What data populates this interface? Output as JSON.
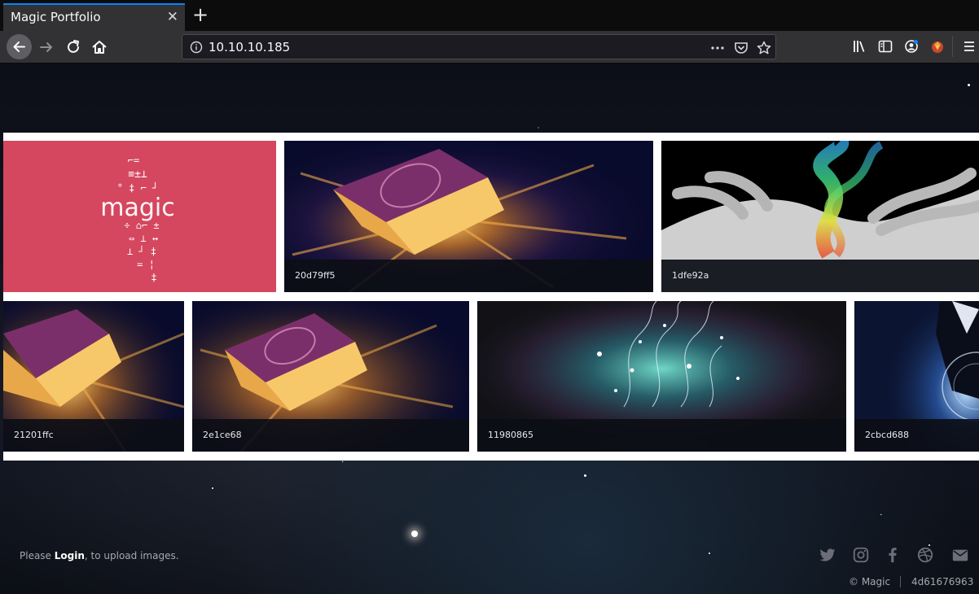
{
  "browser": {
    "tab_title": "Magic Portfolio",
    "url": "10.10.10.185",
    "icons": [
      "back-icon",
      "forward-icon",
      "reload-icon",
      "home-icon",
      "info-icon",
      "more-icon",
      "pocket-icon",
      "bookmark-star-icon",
      "library-icon",
      "sidebar-icon",
      "account-icon",
      "extension-icon",
      "menu-icon"
    ]
  },
  "gallery": {
    "row1": [
      {
        "caption": "",
        "image": "magic-logo"
      },
      {
        "caption": "20d79ff5",
        "image": "glowing-book"
      },
      {
        "caption": "1dfe92a",
        "image": "hand-smoke"
      }
    ],
    "row2": [
      {
        "caption": "21201ffc",
        "image": "glowing-book"
      },
      {
        "caption": "2e1ce68",
        "image": "glowing-book"
      },
      {
        "caption": "11980865",
        "image": "sparkles"
      },
      {
        "caption": "2cbcd688",
        "image": "suit-globe"
      }
    ]
  },
  "footer": {
    "prefix": "Please ",
    "login_label": "Login",
    "suffix": ", to upload images.",
    "copyright": "© Magic",
    "build": "4d61676963",
    "social": [
      "twitter-icon",
      "instagram-icon",
      "facebook-icon",
      "dribbble-icon",
      "email-icon"
    ]
  },
  "colors": {
    "accent": "#0a84ff",
    "magic_tile": "#d4475f"
  }
}
